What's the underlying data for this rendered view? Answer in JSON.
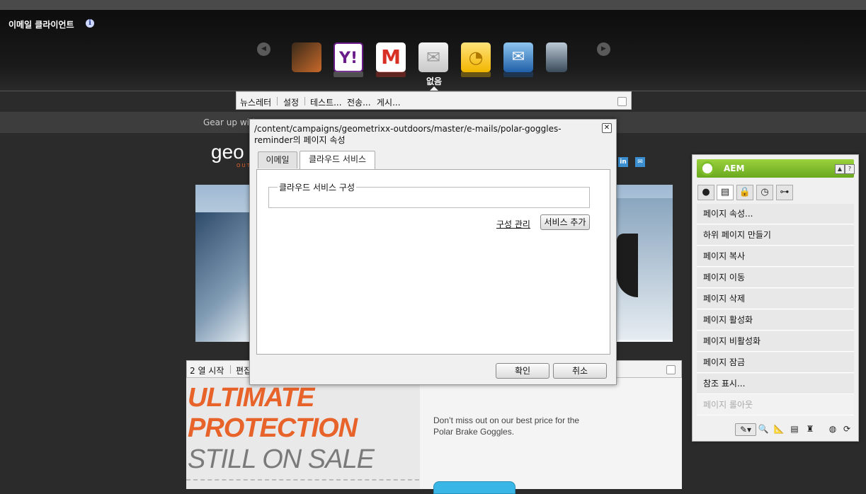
{
  "email_client": {
    "title": "이메일 클라이언트",
    "info_icon": "info-icon",
    "selected_label": "없음",
    "clients": [
      "aol",
      "yahoo",
      "gmail",
      "none",
      "outlook",
      "thunderbird",
      "apple-mail"
    ]
  },
  "newsletter_bar": {
    "items": [
      "뉴스레터",
      "설정",
      "테스트...",
      "전송...",
      "게시..."
    ]
  },
  "page": {
    "gear_text": "Gear up with",
    "logo_text": "geo",
    "logo_sub": "OUT",
    "headline_1": "ULTIMATE",
    "headline_2": "PROTECTION",
    "headline_3": "STILL ON SALE",
    "promo_text": "Don’t miss out on our best price for the Polar Brake Goggles.",
    "column_bar": [
      "2 열 시작",
      "편집"
    ],
    "social": [
      "in",
      "✉"
    ]
  },
  "dialog": {
    "title": "/content/campaigns/geometrixx-outdoors/master/e-mails/polar-goggles-reminder의 페이지 속성",
    "tabs": [
      "이메일",
      "클라우드 서비스"
    ],
    "active_tab": "클라우드 서비스",
    "fieldset_legend": "클라우드 서비스 구성",
    "manage_link": "구성 관리",
    "add_service_button": "서비스 추가",
    "ok_button": "확인",
    "cancel_button": "취소"
  },
  "sidekick": {
    "title": "AEM",
    "items": [
      {
        "label": "페이지 속성...",
        "enabled": true
      },
      {
        "label": "하위 페이지 만들기",
        "enabled": true
      },
      {
        "label": "페이지 복사",
        "enabled": true
      },
      {
        "label": "페이지 이동",
        "enabled": true
      },
      {
        "label": "페이지 삭제",
        "enabled": true
      },
      {
        "label": "페이지 활성화",
        "enabled": true
      },
      {
        "label": "페이지 비활성화",
        "enabled": true
      },
      {
        "label": "페이지 잠금",
        "enabled": true
      },
      {
        "label": "참조 표시...",
        "enabled": true
      },
      {
        "label": "페이지 롤아웃",
        "enabled": false
      }
    ],
    "accent_color": "#7fbf2a"
  }
}
